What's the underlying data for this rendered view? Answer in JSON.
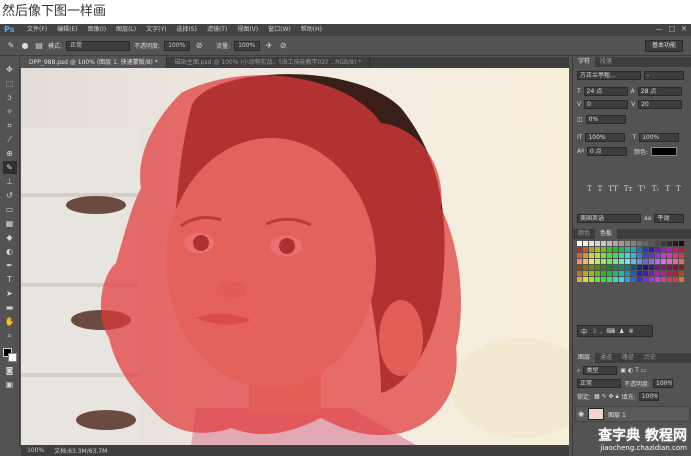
{
  "caption": "然后像下图一样画",
  "app": {
    "logo": "Ps",
    "menu": [
      "文件(F)",
      "编辑(E)",
      "图像(I)",
      "图层(L)",
      "文字(Y)",
      "选择(S)",
      "滤镜(T)",
      "视图(V)",
      "窗口(W)",
      "帮助(H)"
    ],
    "window_controls": [
      "—",
      "□",
      "✕"
    ]
  },
  "options": {
    "mode_label": "模式:",
    "mode_value": "正常",
    "opacity_label": "不透明度:",
    "opacity_value": "100%",
    "flow_label": "流量:",
    "flow_value": "100%",
    "workspace": "基本功能"
  },
  "tabs": [
    "DPP_988.psd @ 100% (图层 1, 快速蒙版/8) *",
    "磁贴主图.psd @ 100% (小动物实战，《海工技能教学02》, RGB/8) *"
  ],
  "status": {
    "zoom": "100%",
    "doc": "文档:63.3M/63.7M"
  },
  "character_panel": {
    "tabs": [
      "字符",
      "段落"
    ],
    "font_family": "方正兰亭粗...",
    "font_style": "-",
    "size": "24 点",
    "leading": "28 点",
    "kerning": "0",
    "tracking": "20",
    "scale_pct": "0%",
    "vscale": "100%",
    "hscale": "100%",
    "baseline": "0 点",
    "color_label": "颜色:",
    "tt_buttons": [
      "T",
      "T",
      "TT",
      "Tт",
      "T¹",
      "T₁",
      "T",
      "T"
    ],
    "language": "美国英语",
    "aa_label": "aa",
    "aa_value": "平滑"
  },
  "swatch_panel": {
    "tabs": [
      "颜色",
      "色板"
    ]
  },
  "mini_tools_label": "中",
  "layers_panel": {
    "tabs": [
      "图层",
      "通道",
      "路径",
      "历史"
    ],
    "filter": "类型",
    "blend": "正常",
    "opacity_label": "不透明度:",
    "opacity_value": "100%",
    "lock_label": "锁定:",
    "fill_label": "填充:",
    "fill_value": "100%",
    "layer_name": "图层 1"
  },
  "watermark": {
    "main": "查字典 教程网",
    "sub": "jiaocheng.chazidian.com"
  },
  "colors": {
    "mask_red": "#e13a3a",
    "ps_blue": "#4db1f5"
  }
}
